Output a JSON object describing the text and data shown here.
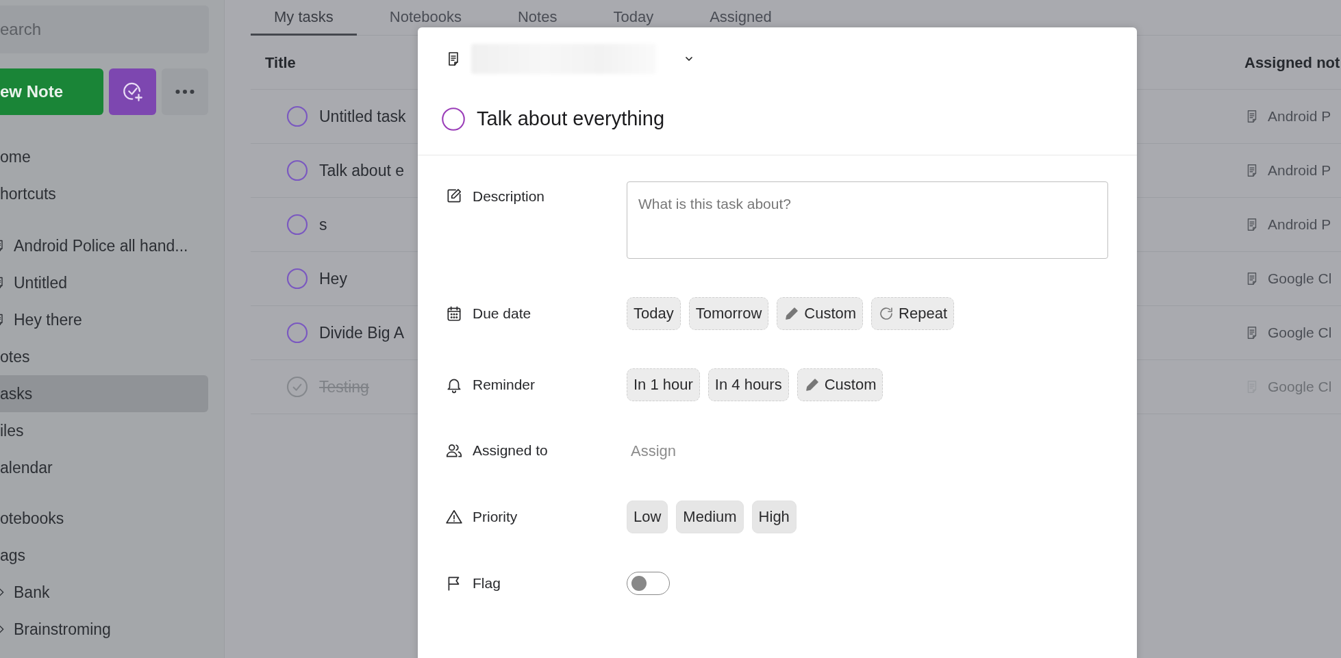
{
  "sidebar": {
    "search": {
      "placeholder": "earch"
    },
    "new_note_button": "ew Note",
    "groups": [
      {
        "items": [
          {
            "label": "ome",
            "selected": false
          },
          {
            "label": "hortcuts",
            "selected": false,
            "children": [
              {
                "label": "Android Police all hand...",
                "selected": false
              },
              {
                "label": "Untitled",
                "selected": false
              },
              {
                "label": "Hey there",
                "selected": false
              }
            ]
          },
          {
            "label": "otes",
            "selected": false
          },
          {
            "label": "asks",
            "selected": true
          },
          {
            "label": "iles",
            "selected": false
          },
          {
            "label": "alendar",
            "selected": false
          }
        ]
      },
      {
        "items": [
          {
            "label": "otebooks",
            "selected": false
          },
          {
            "label": "ags",
            "selected": false,
            "children": [
              {
                "label": "Bank",
                "selected": false
              },
              {
                "label": "Brainstroming",
                "selected": false
              }
            ]
          }
        ]
      }
    ]
  },
  "tabs": [
    {
      "label": "My tasks",
      "selected": true
    },
    {
      "label": "Notebooks",
      "selected": false
    },
    {
      "label": "Notes",
      "selected": false
    },
    {
      "label": "Today",
      "selected": false
    },
    {
      "label": "Assigned",
      "selected": false
    }
  ],
  "table": {
    "columns": [
      "Title",
      "Assigned not"
    ],
    "rows": [
      {
        "title": "Untitled task",
        "done": false,
        "assigned_note": "Android P"
      },
      {
        "title": "Talk about e",
        "done": false,
        "assigned_note": "Android P"
      },
      {
        "title": "s",
        "done": false,
        "assigned_note": "Android P"
      },
      {
        "title": "Hey",
        "done": false,
        "assigned_note": "Google Cl"
      },
      {
        "title": "Divide Big A",
        "done": false,
        "assigned_note": "Google Cl"
      },
      {
        "title": "Testing",
        "done": true,
        "assigned_note": "Google Cl"
      }
    ]
  },
  "task_dialog": {
    "title": "Talk about everything",
    "done": false,
    "fields": [
      {
        "kind": "text",
        "label": "Description",
        "placeholder": "What is this task about?"
      },
      {
        "kind": "chips",
        "label": "Due date",
        "options": [
          {
            "label": "Today",
            "kind": "plain"
          },
          {
            "label": "Tomorrow",
            "kind": "plain"
          },
          {
            "label": "Custom",
            "kind": "custom"
          },
          {
            "label": "Repeat",
            "kind": "repeat"
          }
        ]
      },
      {
        "kind": "chips",
        "label": "Reminder",
        "options": [
          {
            "label": "In 1 hour",
            "kind": "plain"
          },
          {
            "label": "In 4 hours",
            "kind": "plain"
          },
          {
            "label": "Custom",
            "kind": "custom"
          }
        ]
      },
      {
        "kind": "people",
        "label": "Assigned to",
        "placeholder": "Assign"
      },
      {
        "kind": "levels",
        "label": "Priority",
        "options": [
          {
            "label": "Low",
            "selected": false
          },
          {
            "label": "Medium",
            "selected": false
          },
          {
            "label": "High",
            "selected": false
          }
        ]
      },
      {
        "kind": "toggle",
        "label": "Flag",
        "on": false
      }
    ]
  }
}
